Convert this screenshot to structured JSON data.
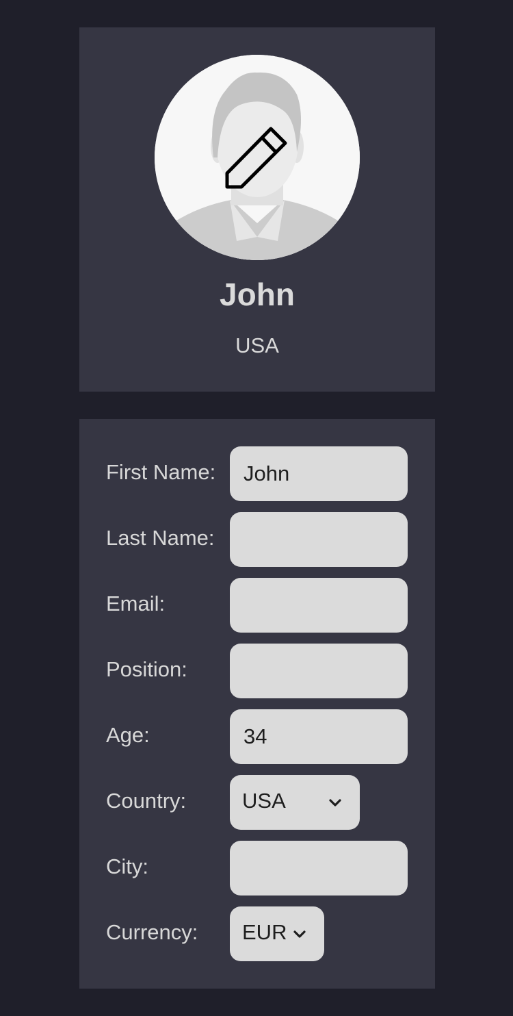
{
  "profile": {
    "name": "John",
    "country": "USA"
  },
  "form": {
    "fields": [
      {
        "label": "First Name:",
        "value": "John",
        "type": "text"
      },
      {
        "label": "Last Name:",
        "value": "",
        "type": "text"
      },
      {
        "label": "Email:",
        "value": "",
        "type": "text"
      },
      {
        "label": "Position:",
        "value": "",
        "type": "text"
      },
      {
        "label": "Age:",
        "value": "34",
        "type": "text"
      },
      {
        "label": "Country:",
        "value": "USA",
        "type": "select"
      },
      {
        "label": "City:",
        "value": "",
        "type": "text"
      },
      {
        "label": "Currency:",
        "value": "EUR",
        "type": "select"
      }
    ]
  },
  "icons": {
    "avatar": "person-silhouette-icon",
    "edit": "pencil-icon",
    "dropdown": "chevron-down-icon"
  },
  "colors": {
    "page_background": "#1f1f2a",
    "card_background": "#363643",
    "field_background": "#dbdbdb",
    "text_light": "#dadada"
  }
}
